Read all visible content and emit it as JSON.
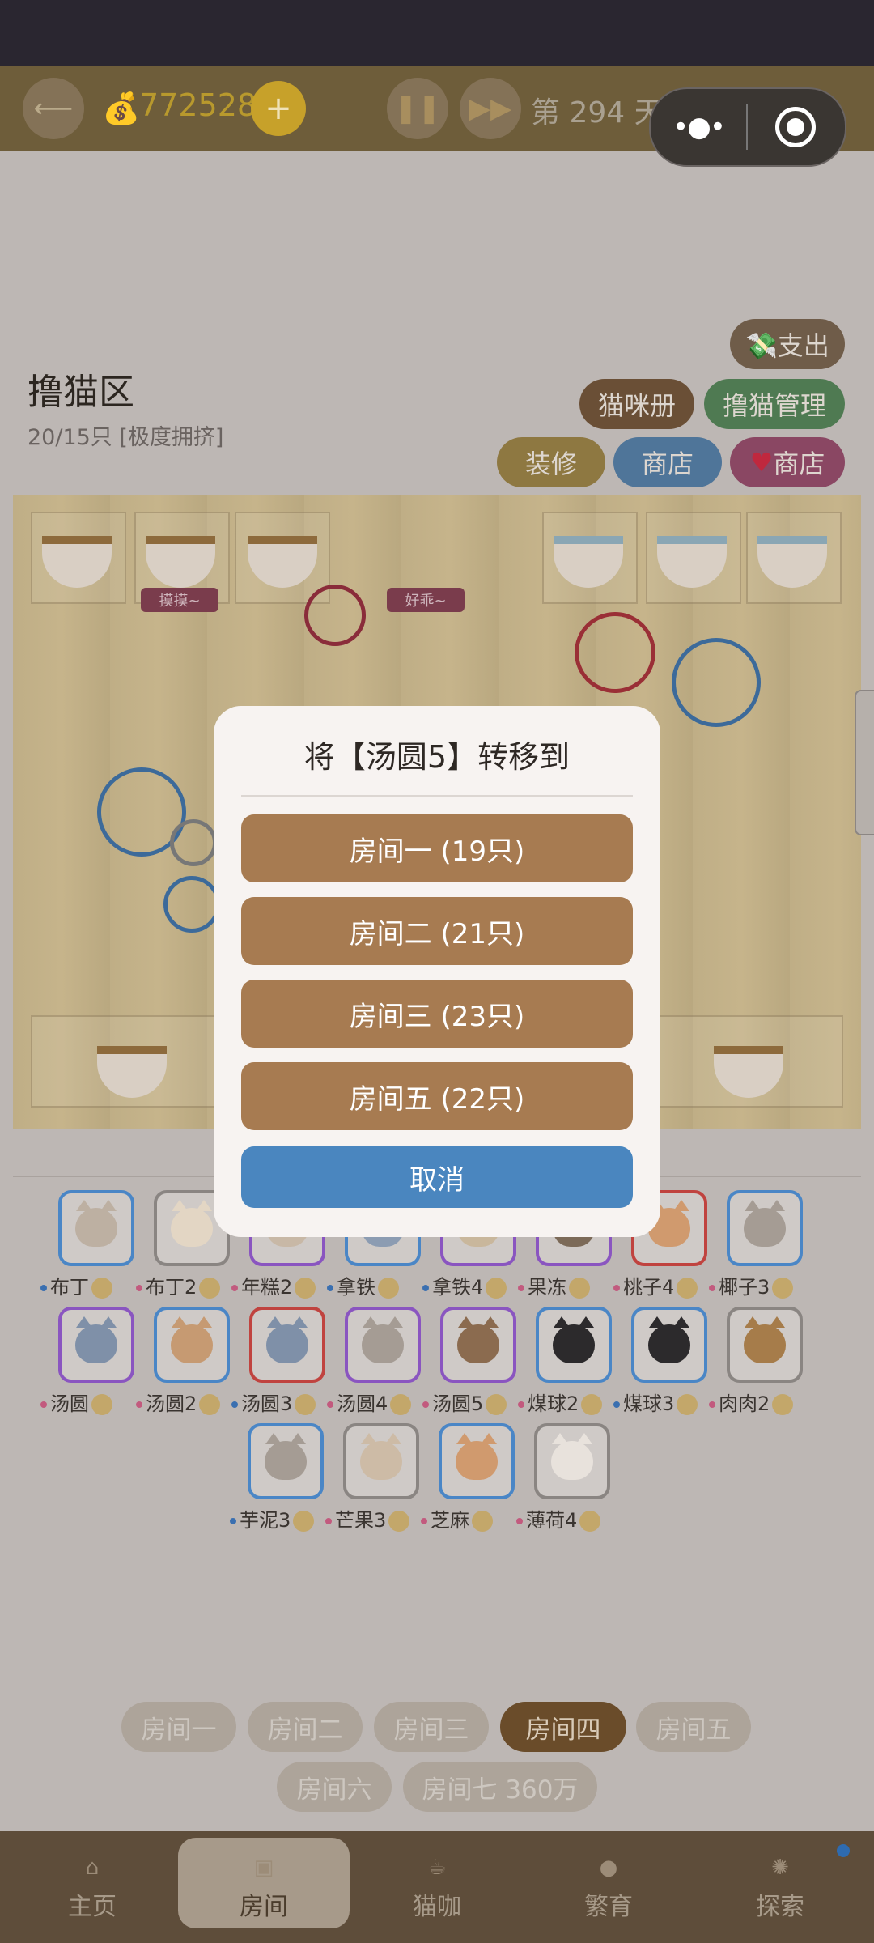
{
  "header": {
    "coins": "772528",
    "plus": "+",
    "day": "第 294 天"
  },
  "area": {
    "title": "撸猫区",
    "count": "20/15只 [极度拥挤]"
  },
  "buttons": {
    "expense": "💸支出",
    "cat_book": "猫咪册",
    "pet_manage": "撸猫管理",
    "decorate": "装修",
    "shop": "商店",
    "heart_shop": "商店"
  },
  "scene": {
    "bubble_left": "摸摸~",
    "bubble_right": "好乖~"
  },
  "cats": [
    {
      "name": "布丁",
      "ring": "#4a86c6",
      "face": "#bdb0a2",
      "dot": "#3a6fb0"
    },
    {
      "name": "布丁2",
      "ring": "#8a8582",
      "face": "#e3d6c4",
      "dot": "#c25a7e"
    },
    {
      "name": "年糕2",
      "ring": "#8a55c0",
      "face": "#c8b8a6",
      "dot": "#c25a7e"
    },
    {
      "name": "拿铁",
      "ring": "#4a86c6",
      "face": "#8c9cb2",
      "dot": "#3a6fb0"
    },
    {
      "name": "拿铁4",
      "ring": "#8a55c0",
      "face": "#c9b79c",
      "dot": "#3a6fb0"
    },
    {
      "name": "果冻",
      "ring": "#8a55c0",
      "face": "#7c6a58",
      "dot": "#c25a7e"
    },
    {
      "name": "桃子4",
      "ring": "#c0433f",
      "face": "#d09a6e",
      "dot": "#c25a7e"
    },
    {
      "name": "椰子3",
      "ring": "#4a86c6",
      "face": "#a59c94",
      "dot": "#c25a7e"
    },
    {
      "name": "汤圆",
      "ring": "#8a55c0",
      "face": "#7f90a8",
      "dot": "#c25a7e"
    },
    {
      "name": "汤圆2",
      "ring": "#4a86c6",
      "face": "#c69a72",
      "dot": "#c25a7e"
    },
    {
      "name": "汤圆3",
      "ring": "#c0433f",
      "face": "#7f90a8",
      "dot": "#3a6fb0"
    },
    {
      "name": "汤圆4",
      "ring": "#8a55c0",
      "face": "#a59c94",
      "dot": "#c25a7e"
    },
    {
      "name": "汤圆5",
      "ring": "#8a55c0",
      "face": "#8b6b4f",
      "dot": "#c25a7e"
    },
    {
      "name": "煤球2",
      "ring": "#4a86c6",
      "face": "#2c2a2c",
      "dot": "#c25a7e"
    },
    {
      "name": "煤球3",
      "ring": "#4a86c6",
      "face": "#2c2a2c",
      "dot": "#3a6fb0"
    },
    {
      "name": "肉肉2",
      "ring": "#8a8582",
      "face": "#a67c4a",
      "dot": "#c25a7e"
    },
    {
      "name": "芋泥3",
      "ring": "#4a86c6",
      "face": "#a59c94",
      "dot": "#3a6fb0"
    },
    {
      "name": "芒果3",
      "ring": "#8a8582",
      "face": "#cdbba6",
      "dot": "#c25a7e"
    },
    {
      "name": "芝麻",
      "ring": "#4a86c6",
      "face": "#d09a6e",
      "dot": "#c25a7e"
    },
    {
      "name": "薄荷4",
      "ring": "#8a8582",
      "face": "#e8e2dc",
      "dot": "#c25a7e"
    }
  ],
  "rooms": [
    "房间一",
    "房间二",
    "房间三",
    "房间四",
    "房间五",
    "房间六",
    "房间七 360万"
  ],
  "nav": [
    "主页",
    "房间",
    "猫咖",
    "繁育",
    "探索"
  ],
  "dialog": {
    "title": "将【汤圆5】转移到",
    "options": [
      "房间一 (19只)",
      "房间二 (21只)",
      "房间三 (23只)",
      "房间五 (22只)"
    ],
    "cancel": "取消"
  }
}
